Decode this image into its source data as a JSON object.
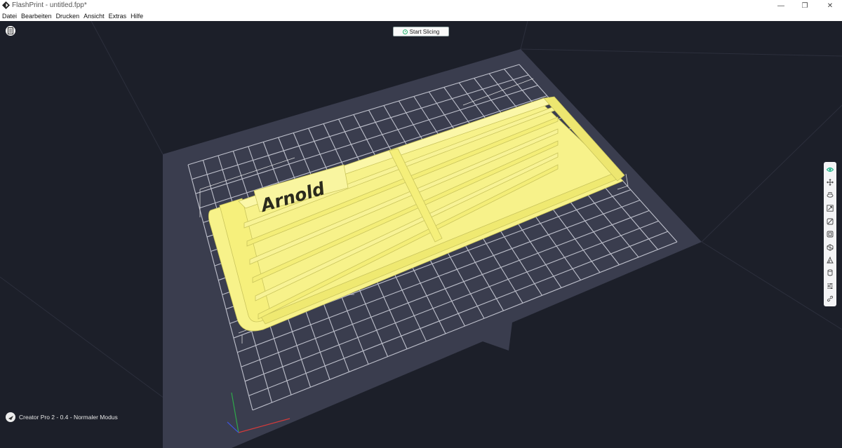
{
  "window": {
    "title": "FlashPrint - untitled.fpp*",
    "minimize_glyph": "—",
    "restore_glyph": "❐",
    "close_glyph": "✕"
  },
  "menu": {
    "items": [
      "Datei",
      "Bearbeiten",
      "Drucken",
      "Ansicht",
      "Extras",
      "Hilfe"
    ]
  },
  "viewport": {
    "slice_button_label": "Start Slicing",
    "model_label": "Arnold",
    "model_color": "#f7f28a",
    "background_color": "#1c1f29",
    "build_plate_color": "#3a3d4e"
  },
  "toolbar": {
    "tools": [
      {
        "name": "view-icon",
        "active": true
      },
      {
        "name": "move-icon",
        "active": false
      },
      {
        "name": "rotate-icon",
        "active": false
      },
      {
        "name": "scale-icon",
        "active": false
      },
      {
        "name": "cut-icon",
        "active": false
      },
      {
        "name": "mirror-icon",
        "active": false
      },
      {
        "name": "support-icon",
        "active": false
      },
      {
        "name": "shell-icon",
        "active": false
      },
      {
        "name": "hollow-icon",
        "active": false
      },
      {
        "name": "settings-icon",
        "active": false
      },
      {
        "name": "link-icon",
        "active": false
      }
    ],
    "active_color": "#1fb38a"
  },
  "status": {
    "text": "Creator Pro 2 - 0.4 - Normaler Modus"
  }
}
